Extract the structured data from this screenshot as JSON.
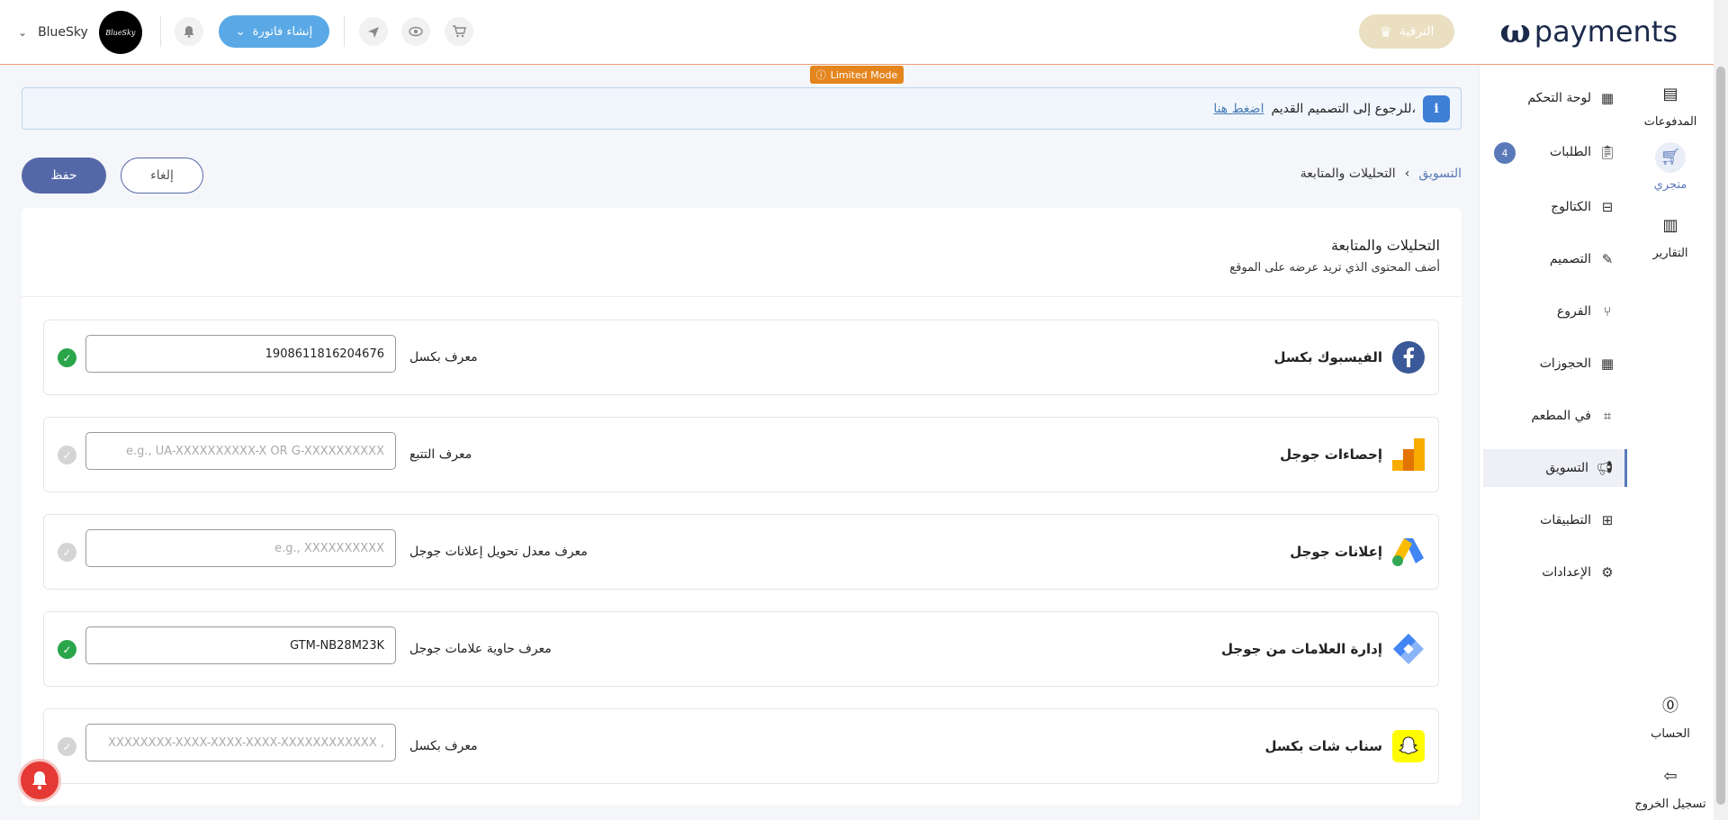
{
  "header": {
    "logo_text": "payments",
    "upgrade_label": "الترقية",
    "invoice_label": "إنشاء فاتورة",
    "user_name": "BlueSky",
    "avatar_text": "BlueSky"
  },
  "rail": [
    {
      "label": "المدفوعات",
      "icon": "receipt-icon"
    },
    {
      "label": "متجري",
      "icon": "cart-icon"
    },
    {
      "label": "التقارير",
      "icon": "chart-icon"
    },
    {
      "label": "الحساب",
      "icon": "account-icon"
    },
    {
      "label": "تسجيل الخروج",
      "icon": "logout-icon"
    }
  ],
  "sidenav": {
    "items": [
      {
        "label": "لوحة التحكم",
        "icon": "dashboard-icon"
      },
      {
        "label": "الطلبات",
        "icon": "orders-icon",
        "badge": "4"
      },
      {
        "label": "الكتالوج",
        "icon": "catalog-icon"
      },
      {
        "label": "التصميم",
        "icon": "design-icon"
      },
      {
        "label": "الفروع",
        "icon": "branches-icon"
      },
      {
        "label": "الحجوزات",
        "icon": "calendar-icon"
      },
      {
        "label": "في المطعم",
        "icon": "qr-icon"
      },
      {
        "label": "التسويق",
        "icon": "megaphone-icon"
      },
      {
        "label": "التطبيقات",
        "icon": "apps-icon"
      },
      {
        "label": "الإعدادات",
        "icon": "settings-icon"
      }
    ]
  },
  "limited_mode": "Limited Mode",
  "banner": {
    "text": "للرجوع إلى التصميم القديم،",
    "link": "اضغط هنا"
  },
  "breadcrumb": {
    "parent": "التسويق",
    "current": "التحليلات والمتابعة"
  },
  "actions": {
    "save": "حفظ",
    "cancel": "إلغاء"
  },
  "card": {
    "title": "التحليلات والمتابعة",
    "subtitle": "أضف المحتوى الذي تريد عرضه على الموقع"
  },
  "integrations": [
    {
      "name": "الفيسبوك بكسل",
      "field_label": "معرف بكسل",
      "value": "1908611816204676",
      "placeholder": "",
      "active": true,
      "icon": "facebook-icon",
      "color": "#3b5998"
    },
    {
      "name": "إحصاءات جوجل",
      "field_label": "معرف التتبع",
      "value": "",
      "placeholder": "e.g., UA-XXXXXXXXXX-X OR G-XXXXXXXXXX",
      "active": false,
      "icon": "google-analytics-icon",
      "color": "#f9ab00"
    },
    {
      "name": "إعلانات جوجل",
      "field_label": "معرف معدل تحويل إعلانات جوجل",
      "value": "",
      "placeholder": "e.g., XXXXXXXXXX",
      "active": false,
      "icon": "google-ads-icon",
      "color": "#4285f4"
    },
    {
      "name": "إدارة العلامات من جوجل",
      "field_label": "معرف حاوية علامات جوجل",
      "value": "GTM-NB28M23K",
      "placeholder": "",
      "active": true,
      "icon": "google-tag-manager-icon",
      "color": "#4a89dc"
    },
    {
      "name": "سناب شات بكسل",
      "field_label": "معرف بكسل",
      "value": "",
      "placeholder": "XXXXXXXX-XXXX-XXXX-XXXX-XXXXXXXXXXXX ,",
      "active": false,
      "icon": "snapchat-icon",
      "color": "#fffc00"
    }
  ]
}
